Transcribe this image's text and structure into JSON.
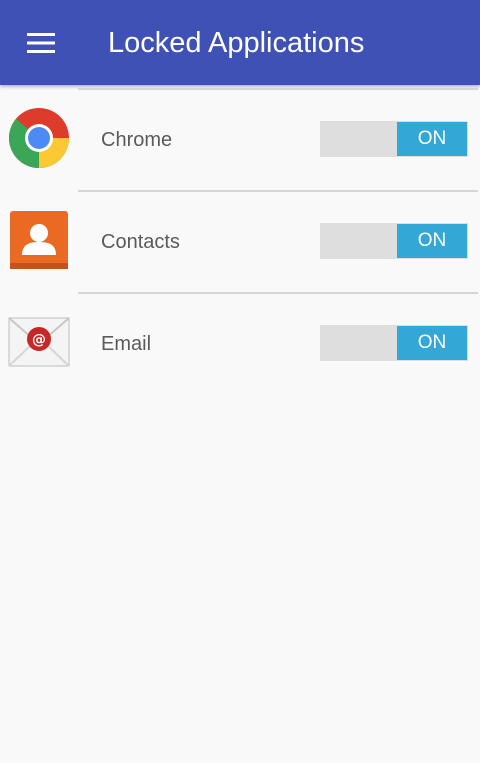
{
  "header": {
    "title": "Locked Applications",
    "menu_icon": "hamburger-menu-icon",
    "background_color": "#3f51b5"
  },
  "apps": [
    {
      "name": "Chrome",
      "icon": "chrome-icon",
      "toggle_label": "ON",
      "locked": true
    },
    {
      "name": "Contacts",
      "icon": "contacts-icon",
      "toggle_label": "ON",
      "locked": true
    },
    {
      "name": "Email",
      "icon": "email-icon",
      "toggle_label": "ON",
      "locked": true
    }
  ],
  "colors": {
    "toggle_on": "#33a7d6",
    "toggle_track": "#dedede"
  }
}
